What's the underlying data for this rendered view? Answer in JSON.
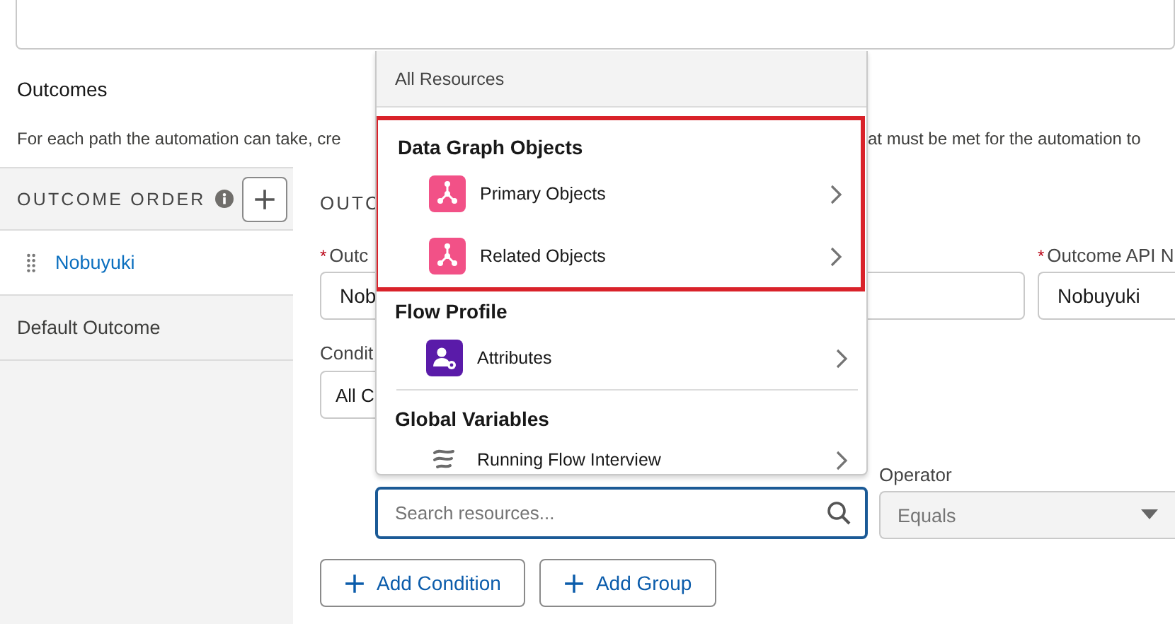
{
  "outcomes_section": {
    "title": "Outcomes",
    "description_left": "For each path the automation can take, cre",
    "description_right": "at must be met for the automation to"
  },
  "outcome_order": {
    "header": "OUTCOME ORDER",
    "items": [
      {
        "label": "Nobuyuki",
        "kind": "custom",
        "selected": true
      },
      {
        "label": "Default Outcome",
        "kind": "default",
        "selected": false
      }
    ]
  },
  "outcome_details": {
    "heading": "OUTC",
    "label_field": {
      "required_mark": "*",
      "label": "Outc",
      "value": "Nob"
    },
    "api_name_field": {
      "required_mark": "*",
      "label": "Outcome API N",
      "value": "Nobuyuki"
    },
    "condition_field": {
      "label": "Condit",
      "value": "All C"
    },
    "resource_search": {
      "placeholder": "Search resources...",
      "focused": true
    },
    "operator_field": {
      "label": "Operator",
      "value": "Equals",
      "disabled": true
    },
    "buttons": [
      {
        "label": "Add Condition"
      },
      {
        "label": "Add Group"
      }
    ]
  },
  "resource_menu": {
    "header": "All Resources",
    "groups": [
      {
        "title": "Data Graph Objects",
        "highlighted": true,
        "items": [
          {
            "label": "Primary Objects",
            "kind": "data-graph"
          },
          {
            "label": "Related Objects",
            "kind": "data-graph"
          }
        ]
      },
      {
        "title": "Flow Profile",
        "highlighted": false,
        "items": [
          {
            "label": "Attributes",
            "kind": "profile"
          }
        ]
      },
      {
        "title": "Global Variables",
        "highlighted": false,
        "items": [
          {
            "label": "Running Flow Interview",
            "kind": "flow"
          }
        ]
      }
    ]
  }
}
